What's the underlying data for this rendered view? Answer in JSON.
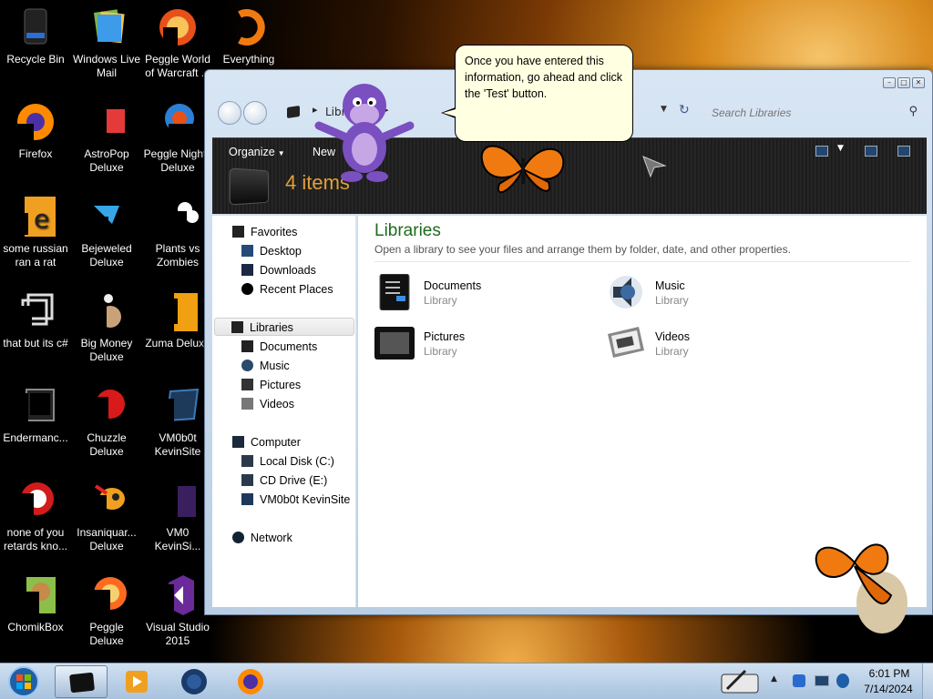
{
  "desktop": {
    "icons": [
      {
        "name": "recycle-bin-icon",
        "label": "Recycle Bin"
      },
      {
        "name": "windows-live-mail-icon",
        "label": "Windows Live Mail"
      },
      {
        "name": "peggle-world-of-warcraft-icon",
        "label": "Peggle World of Warcraft ..."
      },
      {
        "name": "everything-icon",
        "label": "Everything"
      },
      {
        "name": "firefox-icon",
        "label": "Firefox"
      },
      {
        "name": "astropop-deluxe-icon",
        "label": "AstroPop Deluxe"
      },
      {
        "name": "peggle-nights-deluxe-icon",
        "label": "Peggle Nights Deluxe"
      },
      {
        "name": "some-russian-ran-a-rat-icon",
        "label": "some russian ran a rat"
      },
      {
        "name": "bejeweled-deluxe-icon",
        "label": "Bejeweled Deluxe"
      },
      {
        "name": "plants-vs-zombies-icon",
        "label": "Plants vs Zombies"
      },
      {
        "name": "that-but-its-c-icon",
        "label": "that but its c#"
      },
      {
        "name": "big-money-deluxe-icon",
        "label": "Big Money Deluxe"
      },
      {
        "name": "zuma-deluxe-icon",
        "label": "Zuma Deluxe"
      },
      {
        "name": "endermanc-icon",
        "label": "Endermanc..."
      },
      {
        "name": "chuzzle-deluxe-icon",
        "label": "Chuzzle Deluxe"
      },
      {
        "name": "vm0b0t-kevinsite-icon",
        "label": "VM0b0t KevinSite"
      },
      {
        "name": "none-of-you-icon",
        "label": "none of you retards kno..."
      },
      {
        "name": "insaniquarium-deluxe-icon",
        "label": "Insaniquar... Deluxe"
      },
      {
        "name": "vm0-kevinsi-icon",
        "label": "VM0 KevinSi..."
      },
      {
        "name": "chomikbox-icon",
        "label": "ChomikBox"
      },
      {
        "name": "peggle-deluxe-icon",
        "label": "Peggle Deluxe"
      },
      {
        "name": "visual-studio-2015-icon",
        "label": "Visual Studio 2015"
      }
    ]
  },
  "bonzi": {
    "bubble_text": "Once you have entered this information, go ahead and click the 'Test' button."
  },
  "explorer": {
    "address_crumb": "Libraries",
    "search_placeholder": "Search Libraries",
    "toolbar": {
      "organize": "Organize",
      "new": "New"
    },
    "items_count": "4 items",
    "nav": {
      "favorites": "Favorites",
      "desktop": "Desktop",
      "downloads": "Downloads",
      "recent": "Recent Places",
      "libraries": "Libraries",
      "documents": "Documents",
      "music": "Music",
      "pictures": "Pictures",
      "videos": "Videos",
      "computer": "Computer",
      "local_disk": "Local Disk (C:)",
      "cd_drive": "CD Drive (E:)",
      "vm_site": "VM0b0t KevinSite",
      "network": "Network"
    },
    "content": {
      "title": "Libraries",
      "subtitle": "Open a library to see your files and arrange them by folder, date, and other properties.",
      "items": [
        {
          "name": "Documents",
          "type": "Library"
        },
        {
          "name": "Music",
          "type": "Library"
        },
        {
          "name": "Pictures",
          "type": "Library"
        },
        {
          "name": "Videos",
          "type": "Library"
        }
      ]
    }
  },
  "taskbar": {
    "time": "6:01 PM",
    "date": "7/14/2024"
  },
  "colors": {
    "library_title": "#1e6b1e",
    "items_count": "#e0a03a",
    "bubble_bg": "#ffffe1"
  }
}
